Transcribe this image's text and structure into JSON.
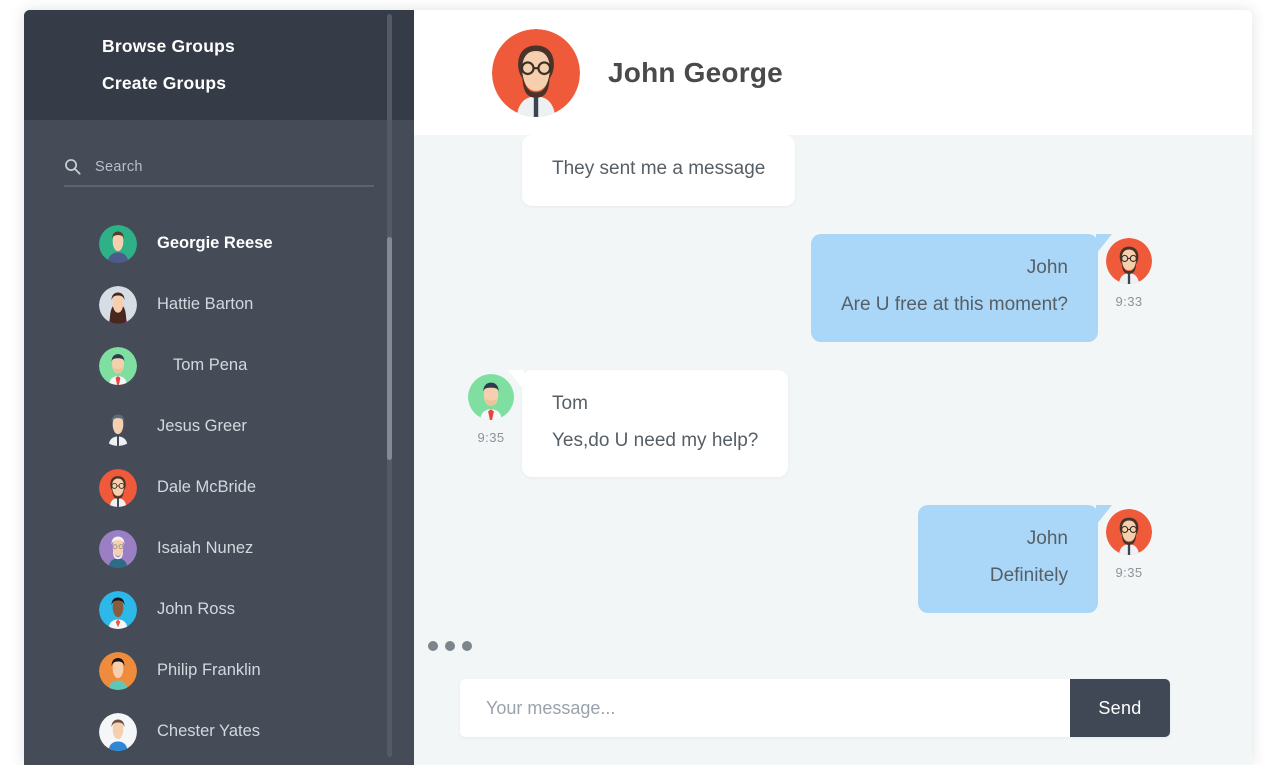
{
  "sidebar": {
    "nav": [
      {
        "label": "Browse Groups",
        "name": "browse-groups-link"
      },
      {
        "label": "Create Groups",
        "name": "create-groups-link"
      }
    ],
    "search": {
      "placeholder": "Search",
      "value": "",
      "icon": "search-icon"
    },
    "contacts": [
      {
        "name": "Georgie Reese",
        "active": true,
        "avatar": "green-teal-woman",
        "indent": false
      },
      {
        "name": "Hattie Barton",
        "active": false,
        "avatar": "grey-longhair-woman",
        "indent": false
      },
      {
        "name": "Tom Pena",
        "active": false,
        "avatar": "green-man-redtie",
        "indent": true
      },
      {
        "name": "Jesus Greer",
        "active": false,
        "avatar": "plain-man-suit",
        "indent": false
      },
      {
        "name": "Dale McBride",
        "active": false,
        "avatar": "orange-bearded-man",
        "indent": false
      },
      {
        "name": "Isaiah Nunez",
        "active": false,
        "avatar": "purple-elder-man",
        "indent": false
      },
      {
        "name": "John Ross",
        "active": false,
        "avatar": "blue-man",
        "indent": false
      },
      {
        "name": "Philip Franklin",
        "active": false,
        "avatar": "orange-man-teal",
        "indent": false
      },
      {
        "name": "Chester Yates",
        "active": false,
        "avatar": "white-man-blue",
        "indent": false
      }
    ],
    "colors": {
      "header_bg": "#353c47",
      "body_bg": "#454c58",
      "active_text": "#ffffff"
    }
  },
  "chat": {
    "header": {
      "title": "John George",
      "avatar": "orange-bearded-man"
    },
    "messages": [
      {
        "id": "m1",
        "direction": "incoming",
        "sender": "",
        "text": "They sent me a message",
        "time": "",
        "avatar": "",
        "show_avatar": false
      },
      {
        "id": "m2",
        "direction": "outgoing",
        "sender": "John",
        "text": "Are U free at this moment?",
        "time": "9:33",
        "avatar": "orange-bearded-man",
        "show_avatar": true
      },
      {
        "id": "m3",
        "direction": "incoming",
        "sender": "Tom",
        "text": "Yes,do U need my help?",
        "time": "9:35",
        "avatar": "green-man-redtie",
        "show_avatar": true
      },
      {
        "id": "m4",
        "direction": "outgoing",
        "sender": "John",
        "text": "Definitely",
        "time": "9:35",
        "avatar": "orange-bearded-man",
        "show_avatar": true
      }
    ],
    "typing_indicator": {
      "visible": true,
      "dots": 3
    },
    "composer": {
      "placeholder": "Your message...",
      "value": "",
      "send_label": "Send"
    },
    "colors": {
      "background": "#f2f6f7",
      "outgoing_bubble": "#aad7f7",
      "incoming_bubble": "#ffffff",
      "send_button": "#3f4854"
    }
  }
}
